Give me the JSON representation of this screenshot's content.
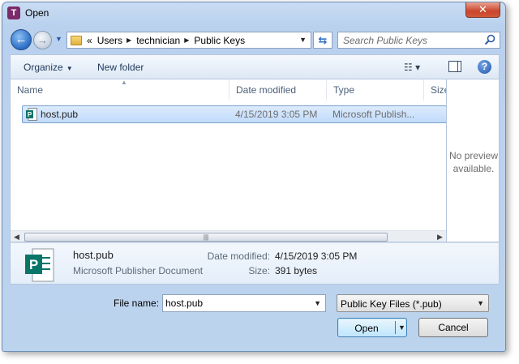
{
  "window": {
    "title": "Open",
    "app_icon_letter": "T",
    "close_glyph": "✕"
  },
  "nav": {
    "back_glyph": "←",
    "forward_glyph": "→",
    "breadcrumb_overflow": "«",
    "breadcrumbs": [
      "Users",
      "technician",
      "Public Keys"
    ],
    "search_placeholder": "Search Public Keys"
  },
  "toolbar": {
    "organize_label": "Organize",
    "new_folder_label": "New folder",
    "help_glyph": "?"
  },
  "columns": [
    "Name",
    "Date modified",
    "Type",
    "Size"
  ],
  "files": [
    {
      "name": "host.pub",
      "date_modified": "4/15/2019 3:05 PM",
      "type": "Microsoft Publish...",
      "selected": true,
      "icon": "publisher-file-icon"
    }
  ],
  "preview": {
    "text_line1": "No preview",
    "text_line2": "available."
  },
  "details": {
    "name": "host.pub",
    "type": "Microsoft Publisher Document",
    "date_label": "Date modified:",
    "date_value": "4/15/2019 3:05 PM",
    "size_label": "Size:",
    "size_value": "391 bytes"
  },
  "bottom": {
    "file_name_label": "File name:",
    "file_name_value": "host.pub",
    "filter_value": "Public Key Files (*.pub)",
    "open_label": "Open",
    "cancel_label": "Cancel"
  },
  "colors": {
    "selection_bg": "#c1dbfc",
    "publisher_green": "#077568",
    "accent_blue": "#2a6cc5"
  }
}
